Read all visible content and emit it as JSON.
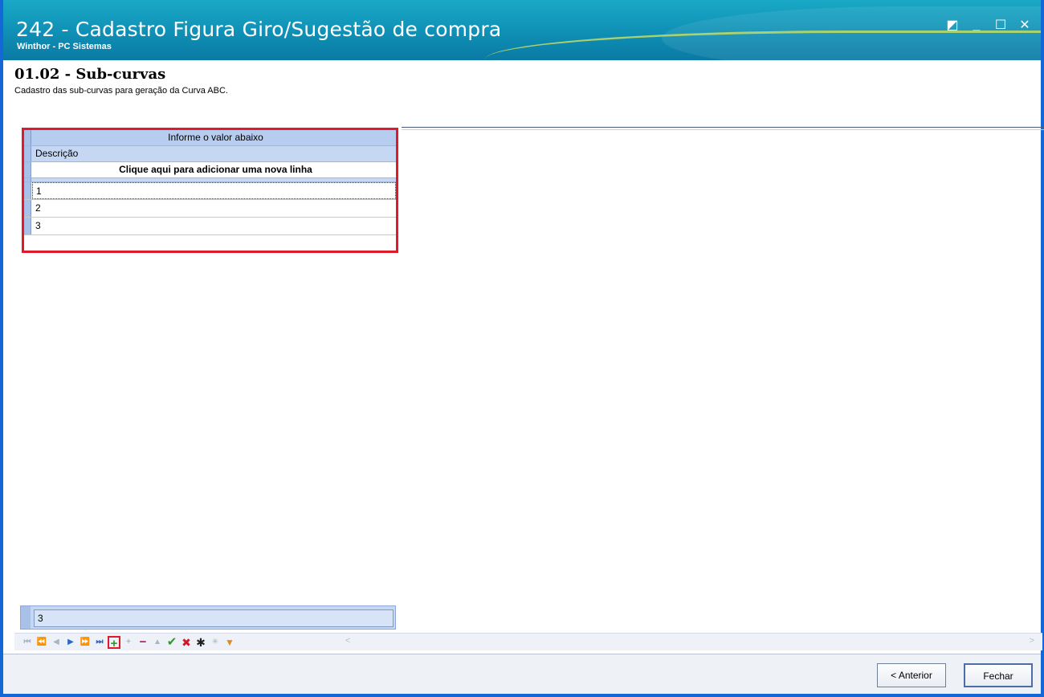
{
  "window": {
    "title": "242 - Cadastro Figura Giro/Sugestão de compra",
    "subtitle": "Winthor - PC Sistemas",
    "controls": {
      "restore": "◩",
      "minimize": "_",
      "maximize": "☐",
      "close": "✕"
    }
  },
  "step": {
    "title": "01.02 - Sub-curvas",
    "description": "Cadastro das sub-curvas para geração da Curva ABC."
  },
  "grid": {
    "group_header": "Informe o valor abaixo",
    "column_header": "Descrição",
    "add_row_text": "Clique aqui para adicionar uma nova linha",
    "rows": [
      "1",
      "2",
      "3"
    ],
    "footer_value": "3"
  },
  "navigator": {
    "buttons": [
      {
        "name": "first-icon",
        "glyph": "⏮",
        "state": "disabled"
      },
      {
        "name": "prev-page-icon",
        "glyph": "⏪",
        "state": "disabled"
      },
      {
        "name": "prev-icon",
        "glyph": "◀",
        "state": "disabled"
      },
      {
        "name": "next-icon",
        "glyph": "▶",
        "state": "enabled"
      },
      {
        "name": "next-page-icon",
        "glyph": "⏩",
        "state": "enabled"
      },
      {
        "name": "last-icon",
        "glyph": "⏭",
        "state": "enabled"
      },
      {
        "name": "insert-icon",
        "glyph": "+",
        "state": "highlighted"
      },
      {
        "name": "append-icon",
        "glyph": "+",
        "state": "disabled"
      },
      {
        "name": "delete-icon",
        "glyph": "−",
        "state": "enabled"
      },
      {
        "name": "edit-icon",
        "glyph": "▲",
        "state": "disabled"
      },
      {
        "name": "post-icon",
        "glyph": "✔",
        "state": "enabled"
      },
      {
        "name": "cancel-icon",
        "glyph": "✖",
        "state": "enabled"
      },
      {
        "name": "refresh-icon",
        "glyph": "✱",
        "state": "enabled"
      },
      {
        "name": "save-bookmark-icon",
        "glyph": "✳",
        "state": "disabled"
      },
      {
        "name": "filter-icon",
        "glyph": "▼",
        "state": "enabled"
      }
    ],
    "scroll_left": "<",
    "scroll_right": ">"
  },
  "buttons": {
    "previous": "< Anterior",
    "close": "Fechar"
  },
  "colors": {
    "titlebar": "#0f8fb5",
    "highlight_border": "#e0192b",
    "grid_header": "#b7cdf0"
  }
}
